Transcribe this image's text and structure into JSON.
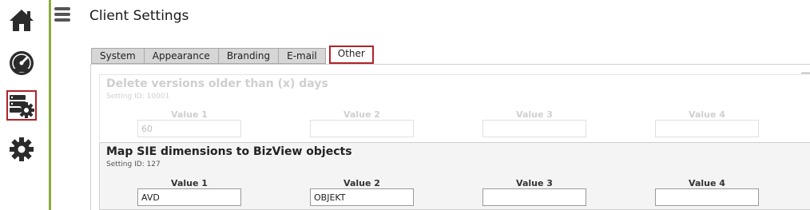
{
  "page": {
    "title": "Client Settings"
  },
  "sidebar": {
    "items": [
      {
        "icon": "home-icon"
      },
      {
        "icon": "dashboard-gauge-icon"
      },
      {
        "icon": "settings-server-icon",
        "active": true
      },
      {
        "icon": "gear-icon"
      }
    ]
  },
  "tabs": [
    {
      "label": "System"
    },
    {
      "label": "Appearance"
    },
    {
      "label": "Branding"
    },
    {
      "label": "E-mail"
    },
    {
      "label": "Other",
      "active": true
    }
  ],
  "settings": [
    {
      "title": "Delete versions older than (x) days",
      "id_text": "Setting ID: 10001",
      "disabled": true,
      "value_labels": [
        "Value 1",
        "Value 2",
        "Value 3",
        "Value 4"
      ],
      "values": [
        "60",
        "",
        "",
        ""
      ]
    },
    {
      "title": "Map SIE dimensions to BizView objects",
      "id_text": "Setting ID: 127",
      "disabled": false,
      "value_labels": [
        "Value 1",
        "Value 2",
        "Value 3",
        "Value 4"
      ],
      "values": [
        "AVD",
        "OBJEKT",
        "",
        ""
      ]
    }
  ],
  "colors": {
    "accent_green": "#8cab3b",
    "active_red": "#b0232a"
  }
}
